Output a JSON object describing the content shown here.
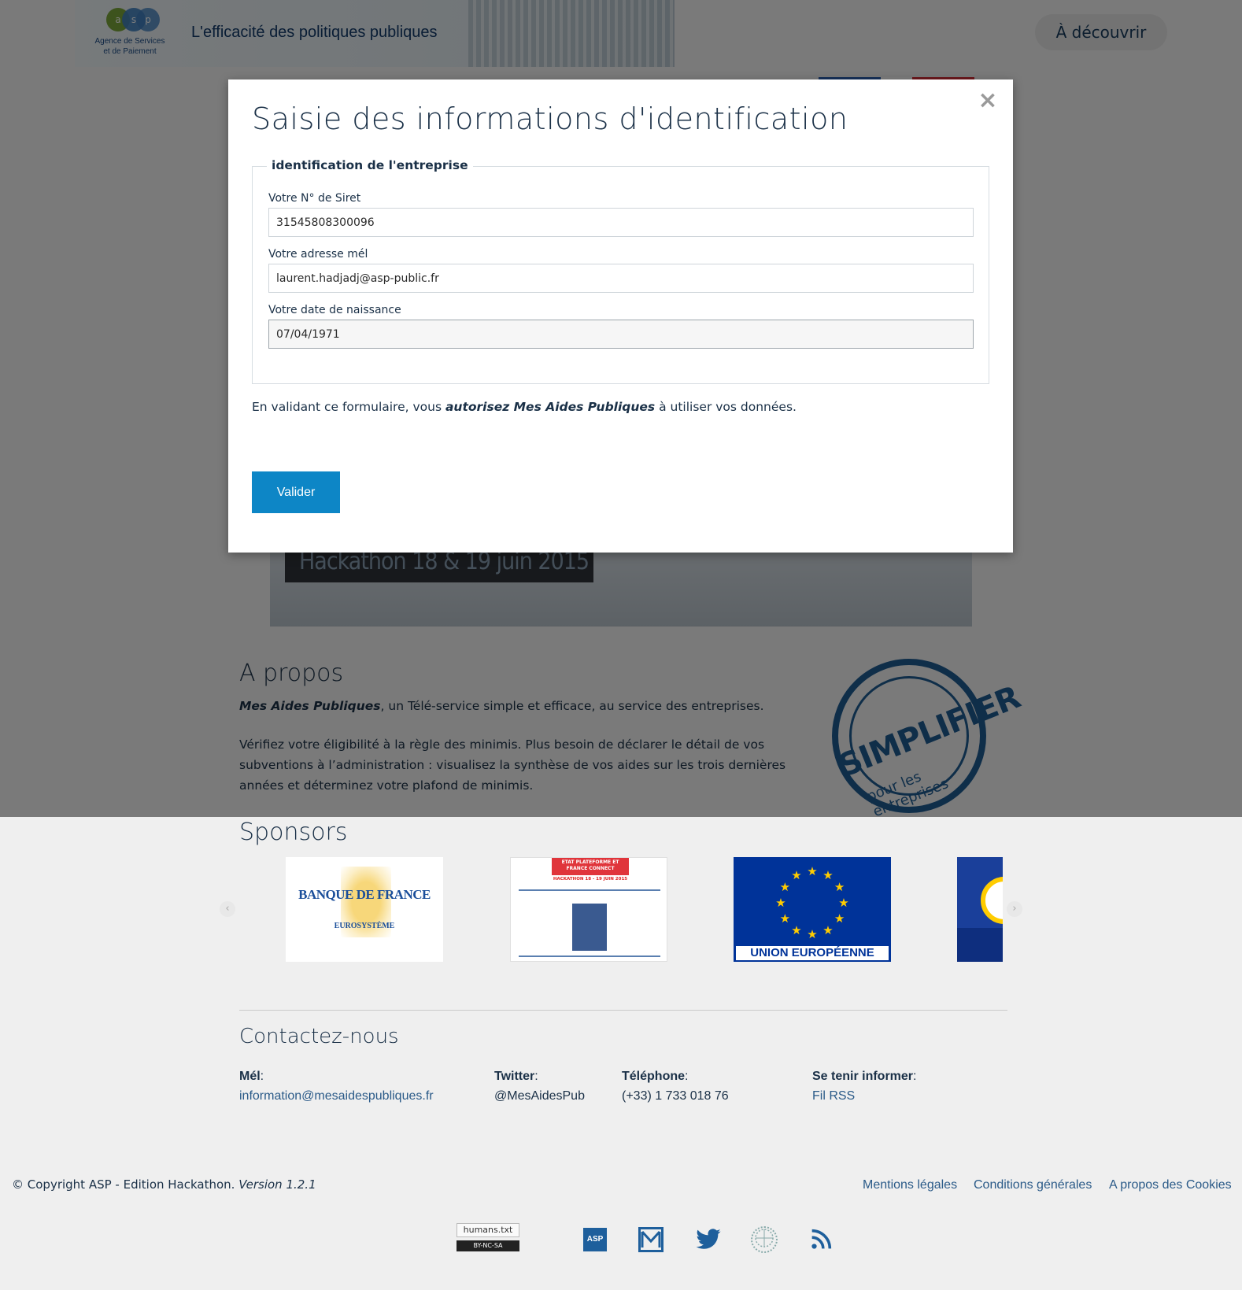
{
  "header": {
    "logo_caption": "Agence de Services\net de Paiement",
    "logo_letters": [
      "a",
      "s",
      "p"
    ],
    "tagline": "L'efficacité des politiques publiques",
    "discover_label": "À découvrir"
  },
  "hero": {
    "caption": "Hackathon 18 & 19 juin 2015"
  },
  "modal": {
    "title": "Saisie des informations d'identification",
    "close_glyph": "×",
    "fieldset_legend": "identification de l'entreprise",
    "fields": [
      {
        "label": "Votre N° de Siret",
        "value": "31545808300096"
      },
      {
        "label": "Votre adresse mél",
        "value": "laurent.hadjadj@asp-public.fr"
      },
      {
        "label": "Votre date de naissance",
        "value": "07/04/1971"
      }
    ],
    "notice_before": "En validant ce formulaire, vous ",
    "notice_emphasis": "autorisez Mes Aides Publiques",
    "notice_after": " à utiliser vos données.",
    "submit_label": "Valider"
  },
  "about": {
    "title": "A propos",
    "p1_emphasis": "Mes Aides Publiques",
    "p1_rest": ", un Télé-service simple et efficace, au service des entreprises.",
    "p2": "Vérifiez votre éligibilité à la règle des minimis. Plus besoin de déclarer le détail de vos subventions à l’administration : visualisez la synthèse de vos aides sur les trois dernières années et déterminez votre plafond de minimis.",
    "stamp_word": "SIMPLIFIER",
    "stamp_sub": "pour les entreprises"
  },
  "sponsors": {
    "title": "Sponsors",
    "prev_glyph": "‹",
    "next_glyph": "›",
    "bdf_name": "BANQUE DE FRANCE",
    "bdf_sub": "EUROSYSTÈME",
    "hackathon_banner": "ETAT PLATEFORME ET FRANCE CONNECT",
    "hackathon_dates": "HACKATHON 18 - 19 JUIN 2015",
    "eu_name": "UNION EUROPÉENNE"
  },
  "contact": {
    "title": "Contactez-nous",
    "items": [
      {
        "label": "Mél",
        "value": "information@mesaidespubliques.fr"
      },
      {
        "label": "Twitter",
        "value": "@MesAidesPub"
      },
      {
        "label": "Téléphone",
        "value": "(+33) 1 733 018 76"
      },
      {
        "label": "Se tenir informer",
        "value": "Fil RSS"
      }
    ]
  },
  "footer": {
    "copyright": "© Copyright ASP - Edition Hackathon.",
    "version": "Version 1.2.1",
    "links": [
      "Mentions légales",
      "Conditions générales",
      "A propos des Cookies"
    ],
    "humans_label": "humans.txt",
    "license_label": "BY-NC-SA",
    "asp_icon_label": "ASP",
    "icons": [
      "humans-txt-icon",
      "asp-icon",
      "mail-icon",
      "twitter-icon",
      "wiki-icon",
      "rss-icon"
    ]
  },
  "colors": {
    "primary_button": "#0d86c6",
    "text_dark": "#1a3047",
    "link": "#2a5a88"
  }
}
